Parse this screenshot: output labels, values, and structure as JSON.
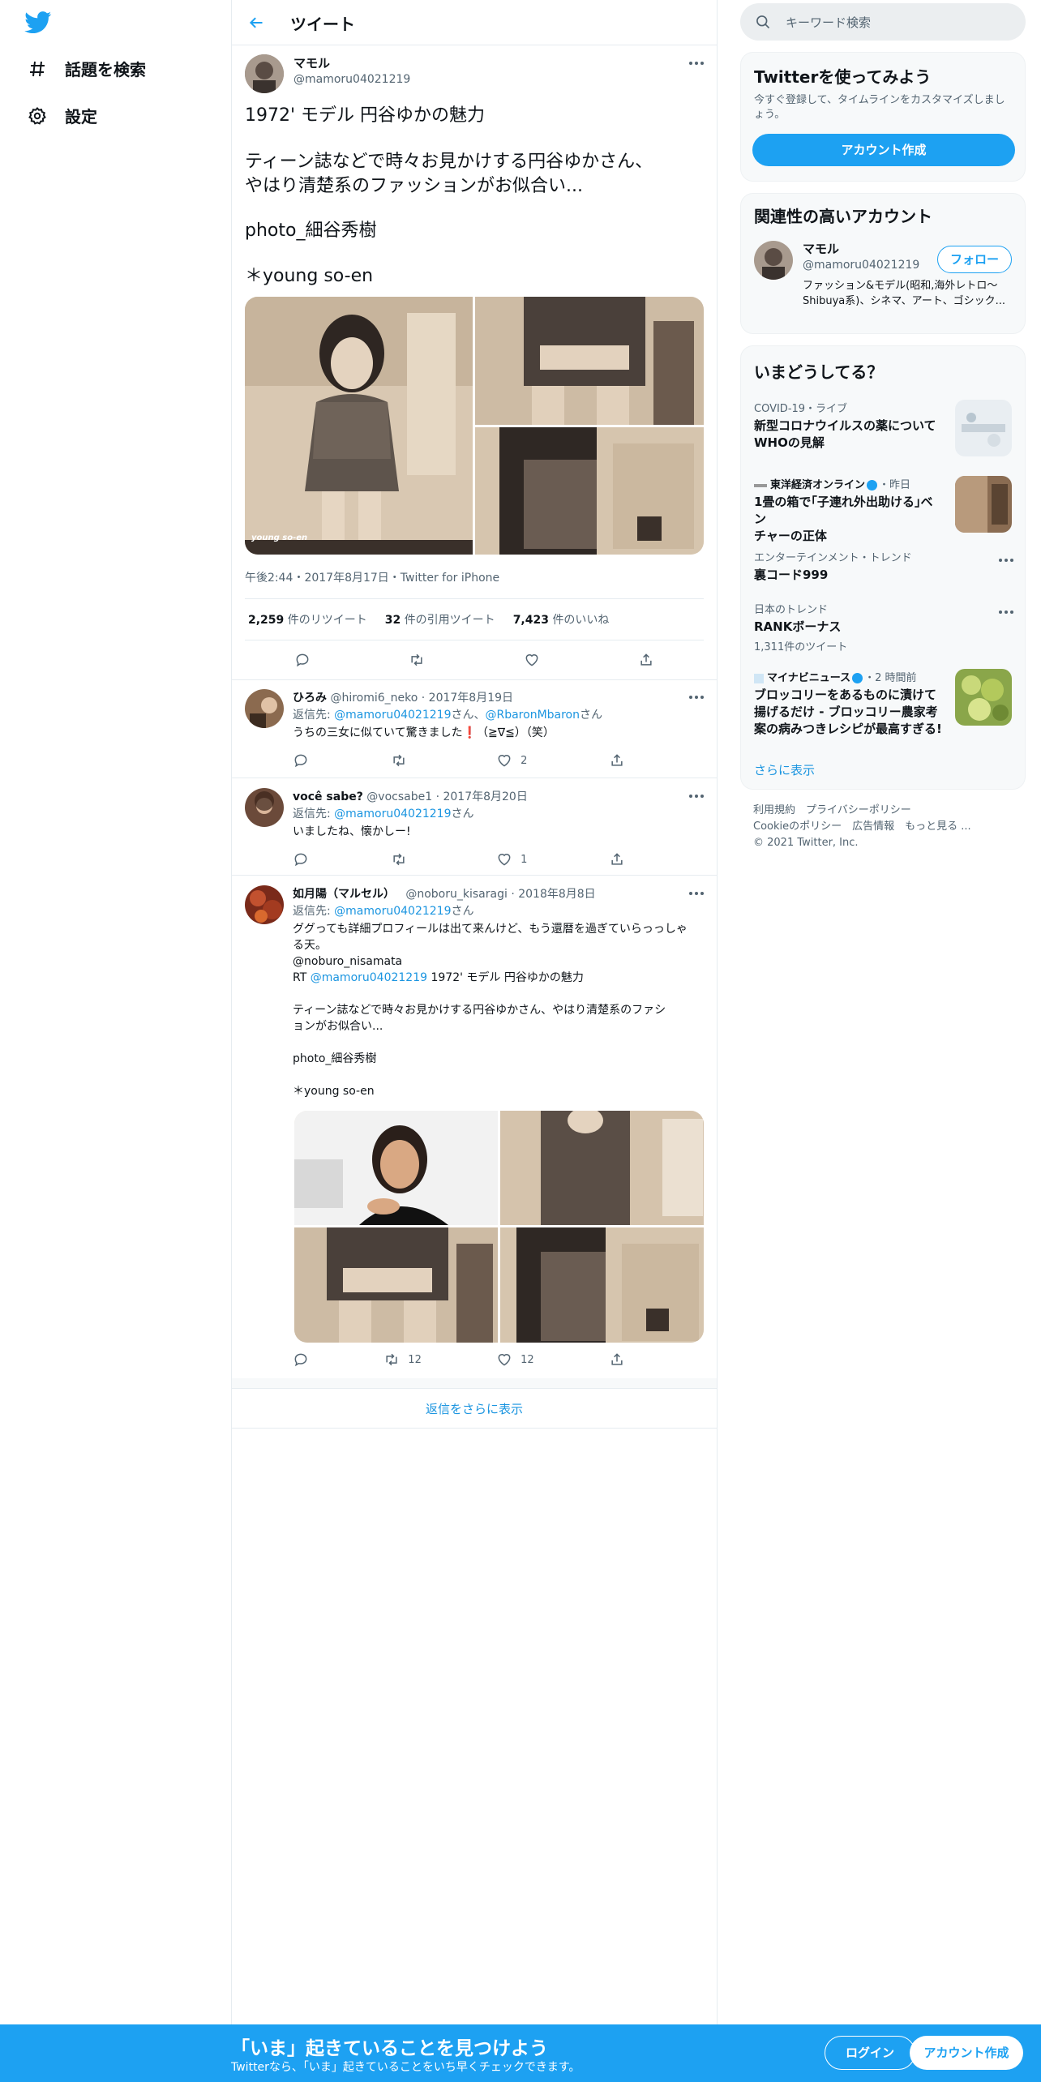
{
  "nav": {
    "explore_label": "話題を検索",
    "settings_label": "設定"
  },
  "header": {
    "title": "ツイート"
  },
  "tweet": {
    "author_name": "マモル",
    "author_handle": "@mamoru04021219",
    "line1": "1972' モデル 円谷ゆかの魅力",
    "line2": "ティーン誌などで時々お見かけする円谷ゆかさん、\nやはり清楚系のファッションがお似合い...",
    "line3": "photo_細谷秀樹",
    "line4": "＊young so-en",
    "timestamp": "午後2:44・2017年8月17日・Twitter for iPhone",
    "retweets_count": "2,259",
    "retweets_label": "件のリツイート",
    "quotes_count": "32",
    "quotes_label": "件の引用ツイート",
    "likes_count": "7,423",
    "likes_label": "件のいいね",
    "photo_watermark": "young so-en"
  },
  "replies": [
    {
      "name": "ひろみ",
      "handle": "@hiromi6_neko",
      "date": "· 2017年8月19日",
      "reply_prefix": "返信先: ",
      "reply_to_1": "@mamoru04021219",
      "reply_mid": "さん、",
      "reply_to_2": "@RbaronMbaron",
      "reply_suffix": "さん",
      "text": "うちの三女に似ていて驚きました❗️（≧∇≦）（笑）",
      "retweets": "",
      "likes": "2"
    },
    {
      "name": "você sabe?",
      "handle": "@vocsabe1",
      "date": "· 2017年8月20日",
      "reply_prefix": "返信先: ",
      "reply_to_1": "@mamoru04021219",
      "reply_suffix": "さん",
      "text": "いましたね、懐かしー!",
      "retweets": "",
      "likes": "1"
    },
    {
      "name": "如月陽（マルセル）",
      "handle": "@noboru_kisaragi",
      "date": "· 2018年8月8日",
      "reply_prefix": "返信先: ",
      "reply_to_1": "@mamoru04021219",
      "reply_suffix": "さん",
      "text_1": "ググっても詳細プロフィールは出て来んけど、もう還暦を過ぎていらっっしゃる天。",
      "text_2": "@noburo_nisamata",
      "rt_prefix": "RT ",
      "rt_handle": "@mamoru04021219",
      "rt_text": " 1972' モデル 円谷ゆかの魅力",
      "text_3": "ティーン誌などで時々お見かけする円谷ゆかさん、やはり清楚系のファシ\nョンがお似合い...",
      "text_4": "photo_細谷秀樹",
      "text_5": "＊young so-en",
      "retweets": "12",
      "likes": "12"
    }
  ],
  "show_more_replies": "返信をさらに表示",
  "sidebar": {
    "search_placeholder": "キーワード検索",
    "signup_card": {
      "title": "Twitterを使ってみよう",
      "desc": "今すぐ登録して、タイムラインをカスタマイズしましょう。",
      "button": "アカウント作成"
    },
    "relevant": {
      "title": "関連性の高いアカウント",
      "name": "マモル",
      "handle": "@mamoru04021219",
      "follow": "フォロー",
      "bio": "ファッション&モデル(昭和,海外レトロ〜Shibuya系)、シネマ、アート、ゴシック..."
    },
    "trends": {
      "title": "いまどうしてる？",
      "items": [
        {
          "context": "COVID-19・ライブ",
          "headline": "新型コロナウイルスの薬について\nWHOの見解"
        },
        {
          "source": "東洋経済オンライン",
          "time": "・昨日",
          "headline": "1畳の箱で｢子連れ外出助ける｣ベン\nチャーの正体"
        },
        {
          "context": "エンターテインメント・トレンド",
          "headline": "裏コード999"
        },
        {
          "context": "日本のトレンド",
          "headline": "RANKボーナス",
          "sub": "1,311件のツイート"
        },
        {
          "source": "マイナビニュース",
          "time": "・2 時間前",
          "headline": "ブロッコリーをあるものに漬けて\n揚げるだけ - ブロッコリー農家考\n案の病みつきレシピが最高すぎる!"
        }
      ],
      "show_more": "さらに表示"
    },
    "footer": {
      "line1": "利用規約　プライバシーポリシー",
      "line2": "Cookieのポリシー　広告情報　もっと見る ...",
      "line3": "© 2021 Twitter, Inc."
    }
  },
  "banner": {
    "title": "「いま」起きていることを見つけよう",
    "subtitle": "Twitterなら、「いま」起きていることをいち早くチェックできます。",
    "login": "ログイン",
    "signup": "アカウント作成"
  },
  "colors": {
    "accent": "#1da1f2",
    "link": "#1b95e0"
  }
}
